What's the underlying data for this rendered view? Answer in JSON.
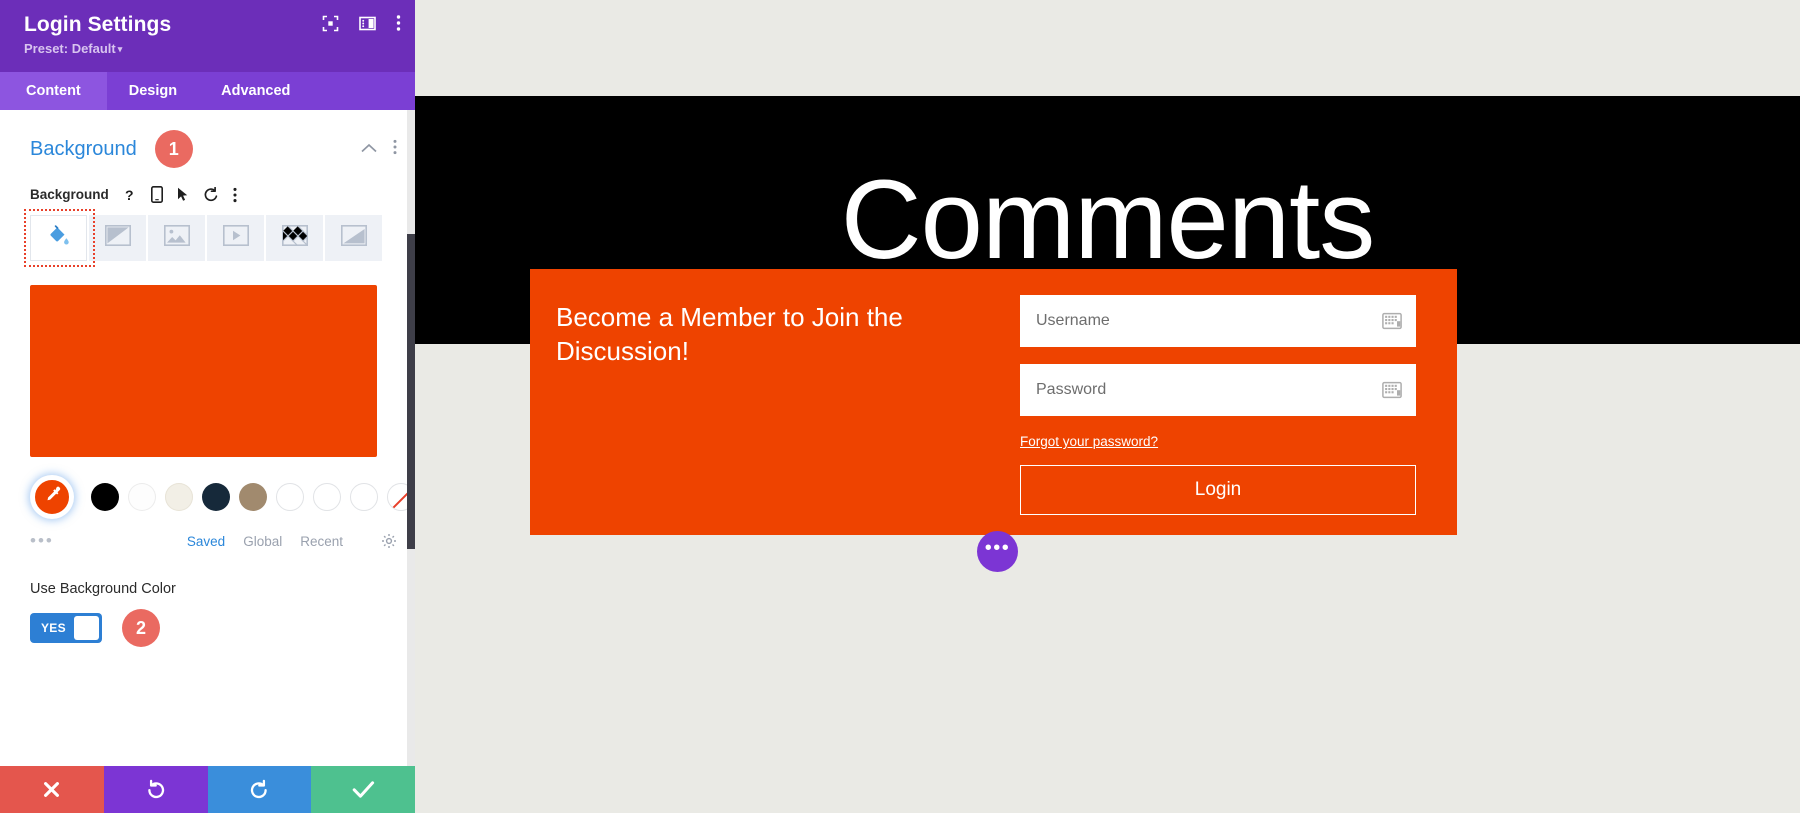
{
  "panel": {
    "header": {
      "title": "Login Settings",
      "preset_label": "Preset: Default",
      "caret": "▾",
      "icons": [
        "focus-mode-icon",
        "panel-layout-icon",
        "more-vertical-icon"
      ]
    },
    "tabs": [
      {
        "label": "Content",
        "active": true
      },
      {
        "label": "Design",
        "active": false
      },
      {
        "label": "Advanced",
        "active": false
      }
    ],
    "section": {
      "title": "Background",
      "badge": "1",
      "collapse_icon": "chevron-up-icon",
      "menu_icon": "more-vertical-icon"
    },
    "field": {
      "label": "Background",
      "icons": [
        "help-icon",
        "responsive-mobile-icon",
        "hover-pointer-icon",
        "reset-icon",
        "more-vertical-icon"
      ]
    },
    "background_types": [
      {
        "name": "color-fill",
        "active": true
      },
      {
        "name": "gradient",
        "active": false
      },
      {
        "name": "image",
        "active": false
      },
      {
        "name": "video",
        "active": false
      },
      {
        "name": "pattern",
        "active": false
      },
      {
        "name": "mask",
        "active": false
      }
    ],
    "selected_color": "#ee4300",
    "swatches": [
      {
        "name": "eyedropper-active",
        "color": "#ee4300",
        "kind": "picker"
      },
      {
        "name": "black",
        "color": "#000000",
        "kind": "solid"
      },
      {
        "name": "white",
        "color": "#fdfdfd",
        "kind": "solid"
      },
      {
        "name": "cream",
        "color": "#f2efe6",
        "kind": "solid"
      },
      {
        "name": "navy",
        "color": "#16293a",
        "kind": "solid"
      },
      {
        "name": "tan",
        "color": "#a18a6e",
        "kind": "solid"
      },
      {
        "name": "empty-1",
        "color": "#ffffff",
        "kind": "empty"
      },
      {
        "name": "empty-2",
        "color": "#ffffff",
        "kind": "empty"
      },
      {
        "name": "empty-3",
        "color": "#ffffff",
        "kind": "empty"
      },
      {
        "name": "transparent",
        "color": "#ffffff",
        "kind": "transparent"
      }
    ],
    "palette": {
      "more_dots": "•••",
      "tabs": [
        {
          "label": "Saved",
          "active": true
        },
        {
          "label": "Global",
          "active": false
        },
        {
          "label": "Recent",
          "active": false
        }
      ],
      "settings_icon": "gear-icon"
    },
    "toggle": {
      "label": "Use Background Color",
      "value": "YES",
      "badge": "2"
    },
    "actions": [
      {
        "name": "cancel",
        "icon": "✕",
        "color": "#e4564d"
      },
      {
        "name": "undo",
        "icon": "↺",
        "color": "#7c35d4"
      },
      {
        "name": "redo",
        "icon": "↻",
        "color": "#3a8edb"
      },
      {
        "name": "save",
        "icon": "✓",
        "color": "#4ec18f"
      }
    ]
  },
  "preview": {
    "banner_text": "Comments",
    "login": {
      "heading": "Become a Member to Join the Discussion!",
      "username_placeholder": "Username",
      "password_placeholder": "Password",
      "forgot_link": "Forgot your password?",
      "submit_label": "Login",
      "background_color": "#ee4300"
    },
    "fab_icon": "•••"
  }
}
